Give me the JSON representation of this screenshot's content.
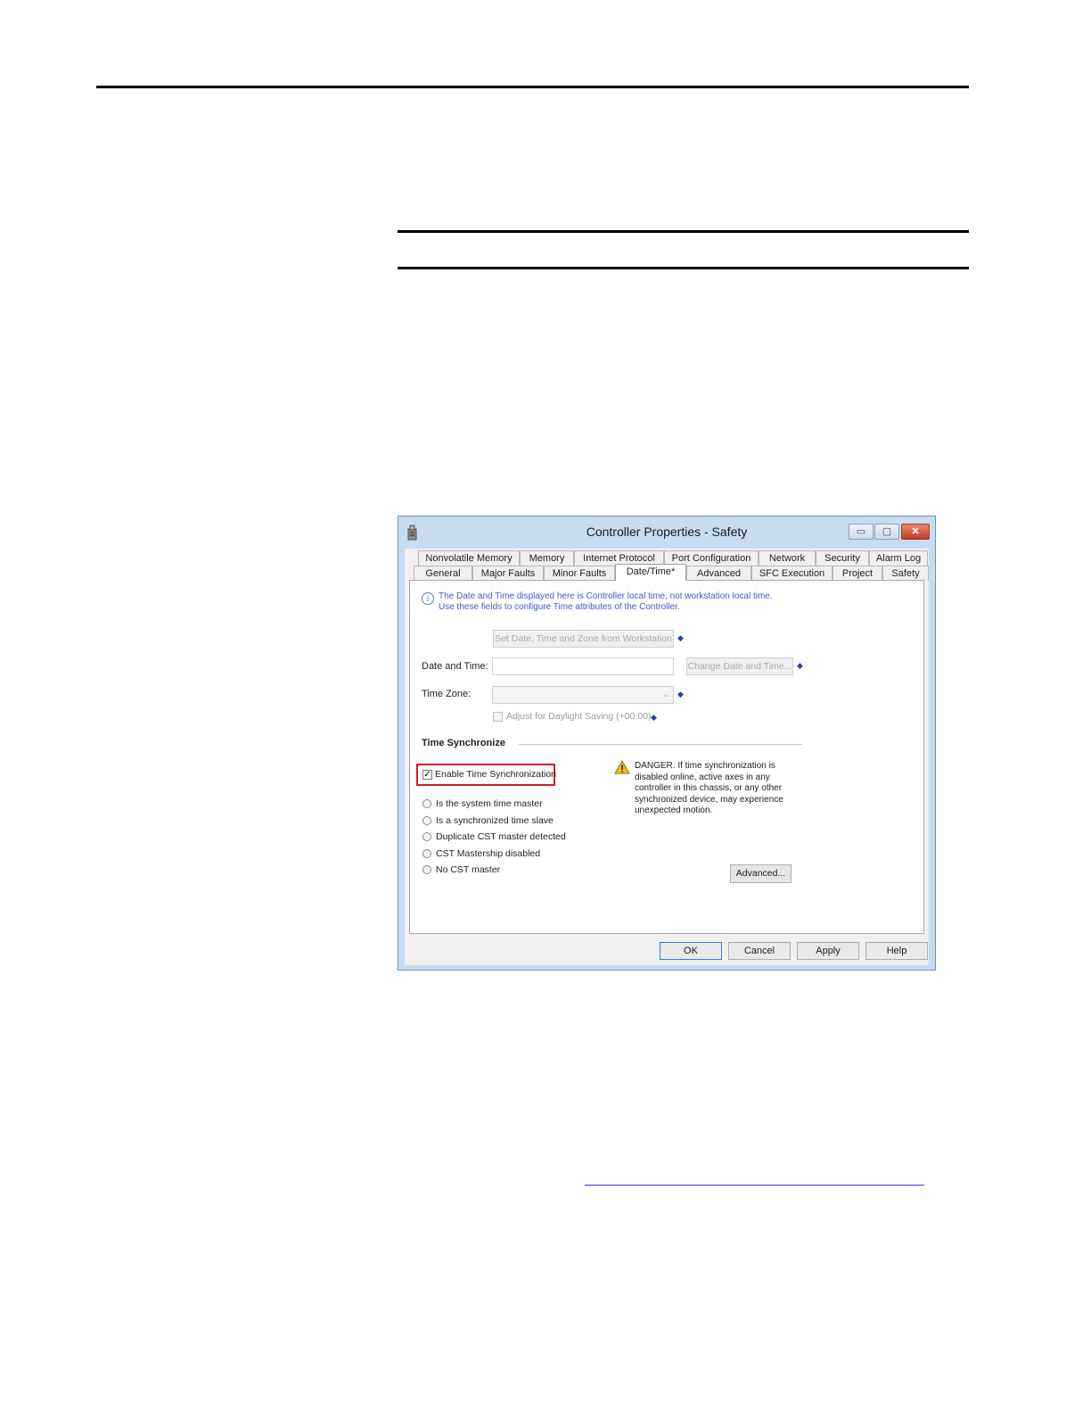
{
  "dialog": {
    "title": "Controller Properties - Safety",
    "window_buttons": {
      "minimize": "▭",
      "maximize": "▢",
      "close": "✕"
    },
    "tabs_row1": [
      "Nonvolatile Memory",
      "Memory",
      "Internet Protocol",
      "Port Configuration",
      "Network",
      "Security",
      "Alarm Log"
    ],
    "tabs_row2": [
      "General",
      "Major Faults",
      "Minor Faults",
      "Date/Time*",
      "Advanced",
      "SFC Execution",
      "Project",
      "Safety"
    ],
    "active_tab": "Date/Time*",
    "info_line1": "The Date and Time displayed here is Controller local time, not workstation local time.",
    "info_line2": "Use these fields to configure Time attributes of the Controller.",
    "set_from_workstation_label": "Set Date, Time and Zone from Workstation",
    "date_time_label": "Date and Time:",
    "date_time_value": "",
    "change_date_time_label": "Change Date and Time...",
    "time_zone_label": "Time Zone:",
    "time_zone_value": "",
    "daylight_saving_label": "Adjust for Daylight Saving (+00:00)",
    "time_sync_title": "Time Synchronize",
    "enable_sync_label": "Enable Time Synchronization",
    "enable_sync_checked": true,
    "radio_options": [
      "Is the system time master",
      "Is a synchronized time slave",
      "Duplicate CST master detected",
      "CST Mastership disabled",
      "No CST master"
    ],
    "danger_lines": [
      "DANGER. If time synchronization is",
      "disabled online, active axes in any",
      "controller in this chassis, or any other",
      "synchronized device, may experience",
      "unexpected motion."
    ],
    "advanced_button": "Advanced...",
    "footer_buttons": {
      "ok": "OK",
      "cancel": "Cancel",
      "apply": "Apply",
      "help": "Help"
    },
    "colors": {
      "highlight": "#d21f26",
      "info_text": "#3a5cc8",
      "frame": "#c8dcef"
    }
  }
}
